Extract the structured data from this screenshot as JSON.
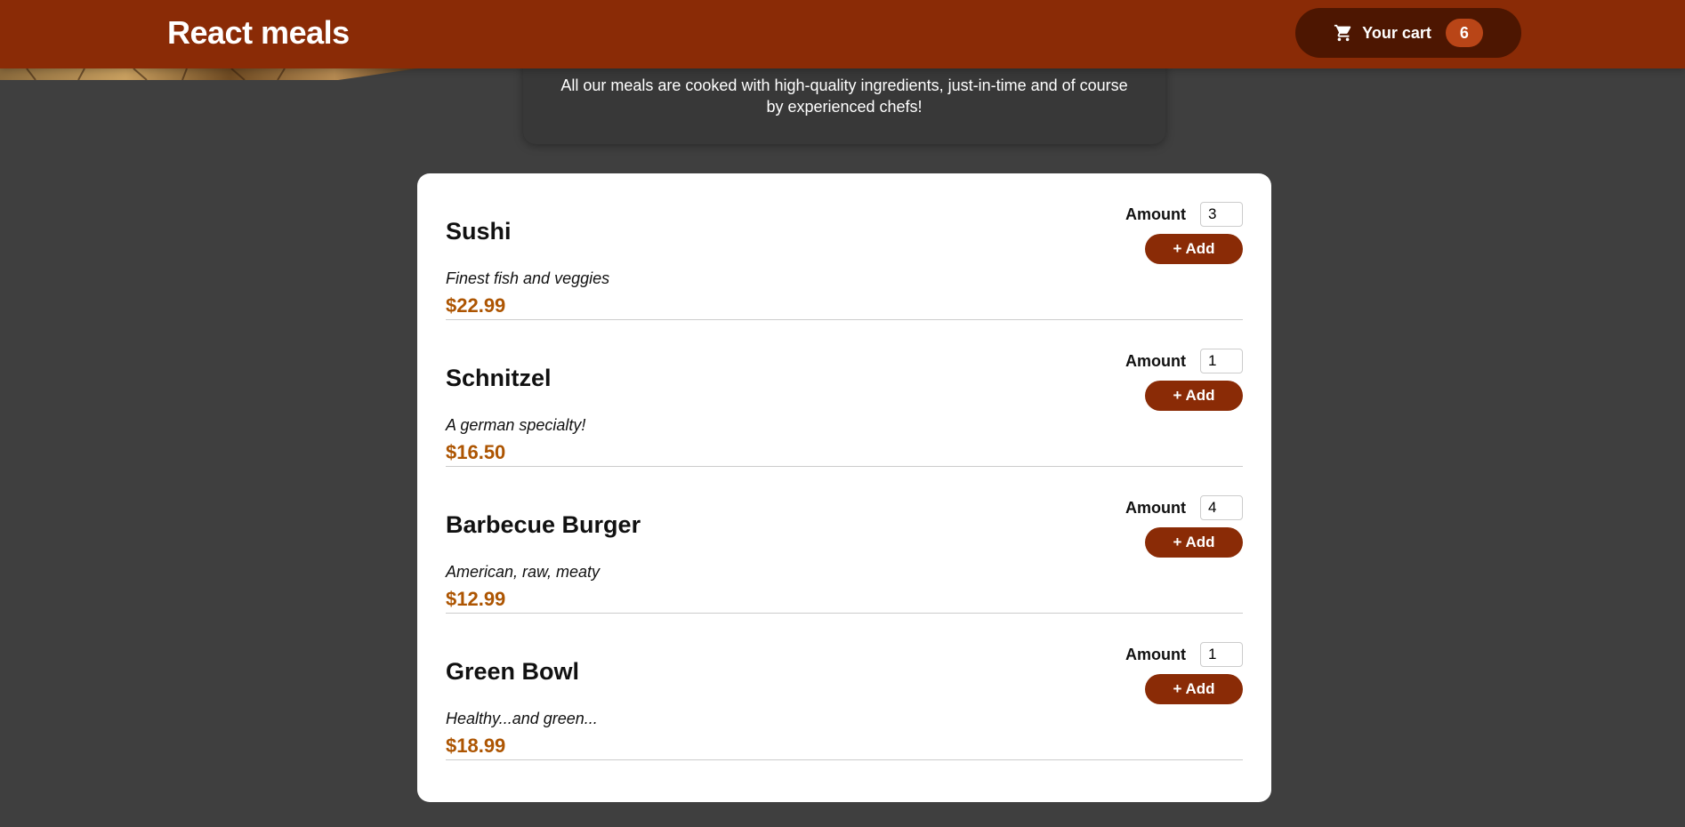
{
  "header": {
    "title": "React meals",
    "cart": {
      "icon": "cart-icon",
      "label": "Your cart",
      "count": "6"
    }
  },
  "summary": {
    "text": "All our meals are cooked with high-quality ingredients, just-in-time and of course by experienced chefs!"
  },
  "meals": [
    {
      "name": "Sushi",
      "description": "Finest fish and veggies",
      "price": "$22.99",
      "amount_label": "Amount",
      "amount": "3",
      "add_label": "+ Add"
    },
    {
      "name": "Schnitzel",
      "description": "A german specialty!",
      "price": "$16.50",
      "amount_label": "Amount",
      "amount": "1",
      "add_label": "+ Add"
    },
    {
      "name": "Barbecue Burger",
      "description": "American, raw, meaty",
      "price": "$12.99",
      "amount_label": "Amount",
      "amount": "4",
      "add_label": "+ Add"
    },
    {
      "name": "Green Bowl",
      "description": "Healthy...and green...",
      "price": "$18.99",
      "amount_label": "Amount",
      "amount": "1",
      "add_label": "+ Add"
    }
  ],
  "colors": {
    "header": "#8a2b06",
    "cart_button": "#4d1601",
    "badge": "#b94517",
    "price": "#ad5502",
    "background": "#3f3f3f"
  }
}
